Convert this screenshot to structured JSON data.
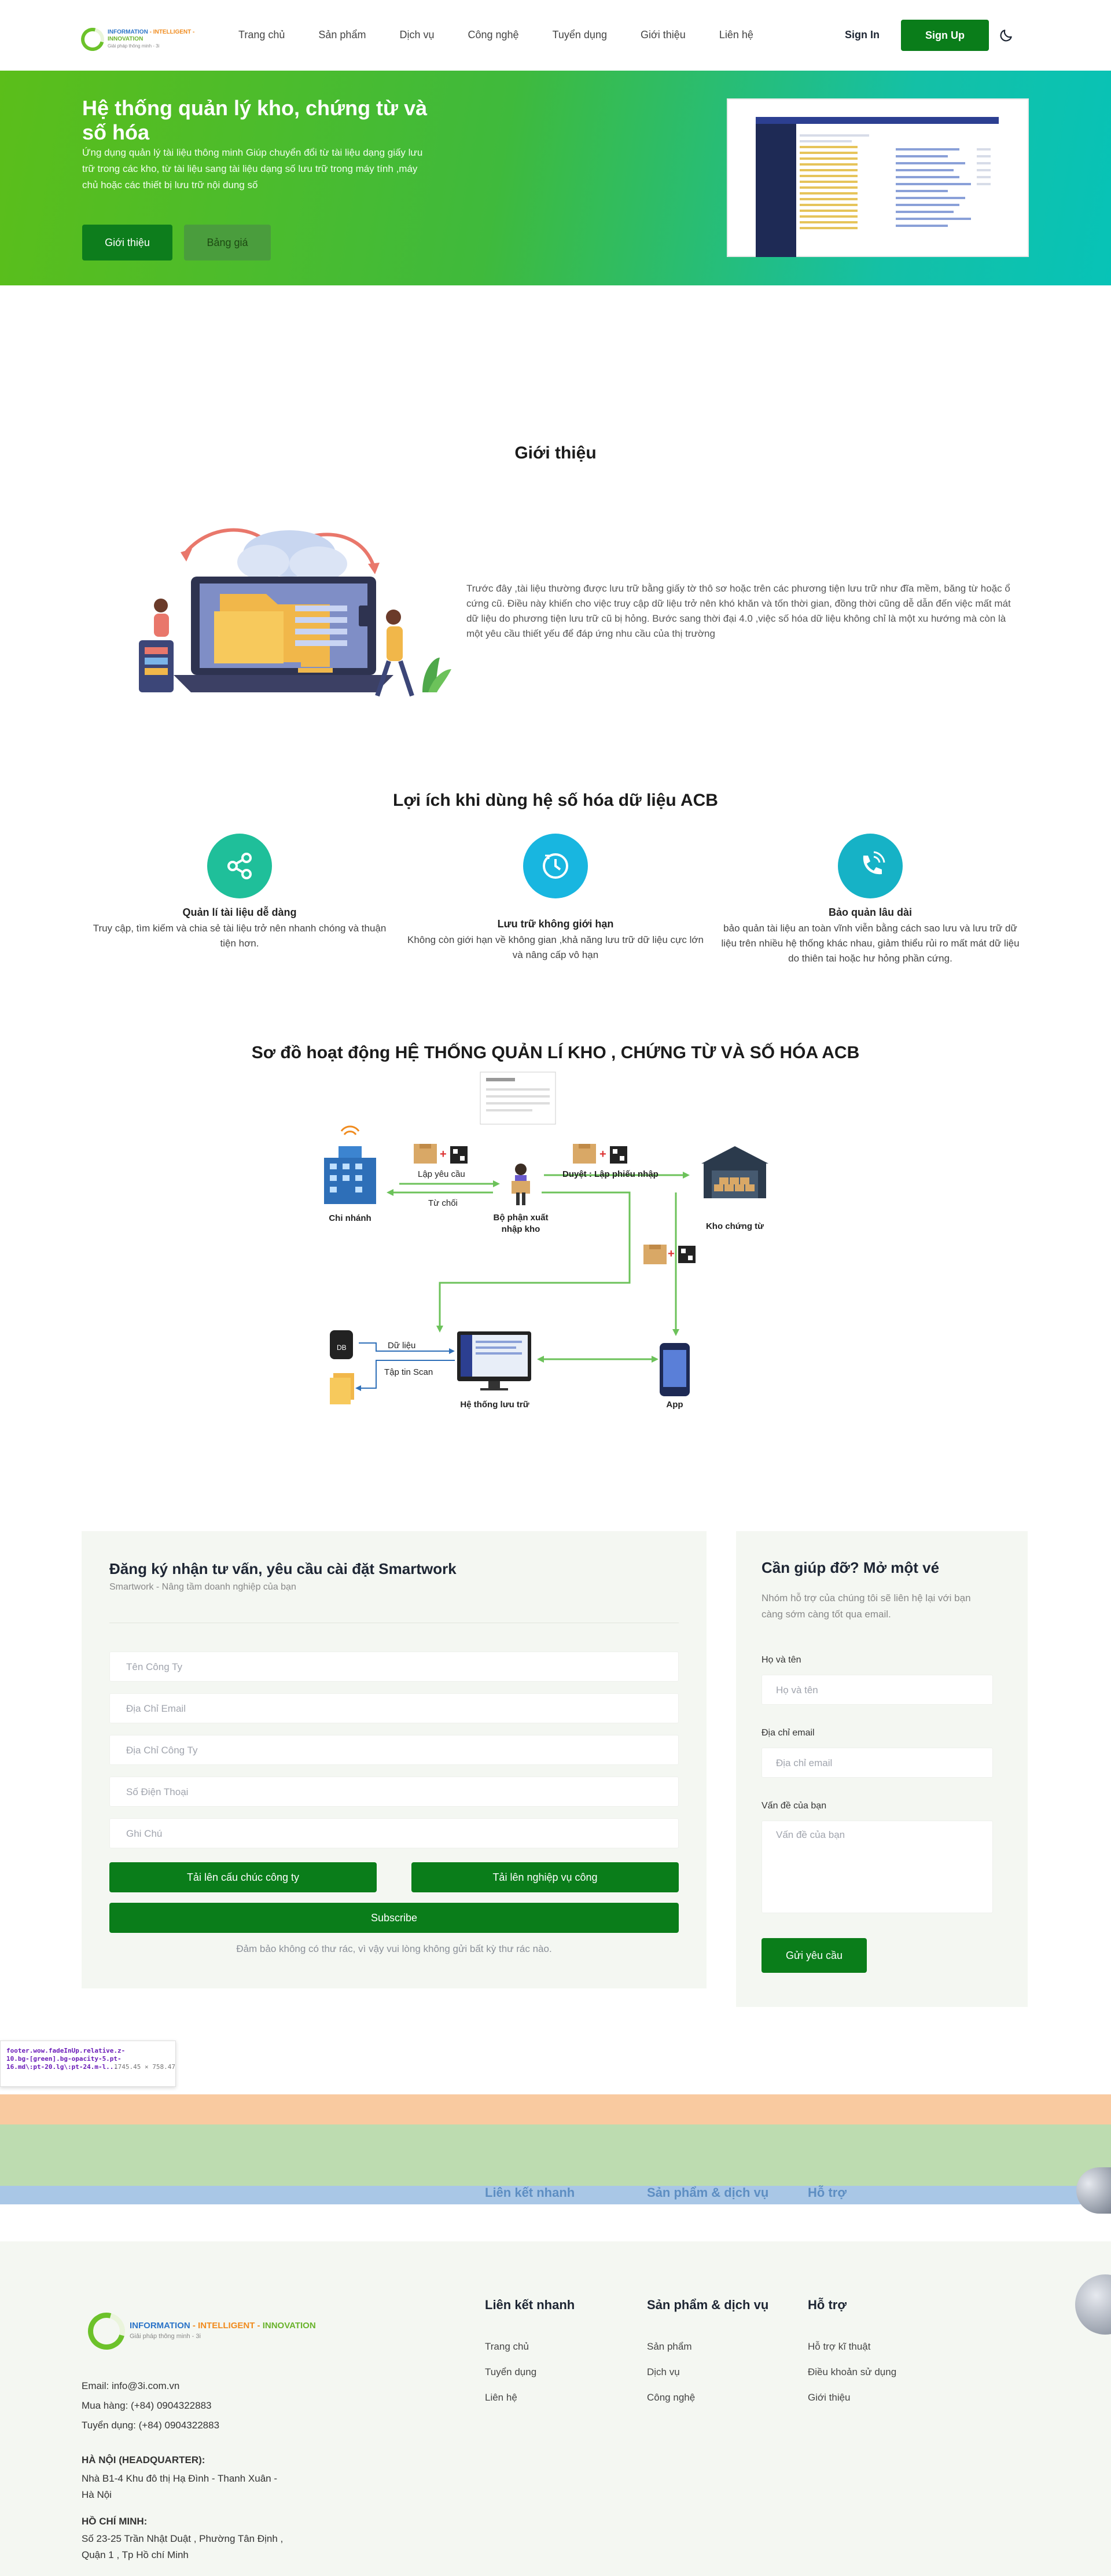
{
  "header": {
    "logo_text": [
      "INFORMATION",
      " - INTELLIGENT - ",
      "INNOVATION"
    ],
    "logo_sub": "Giải pháp thông minh - 3i",
    "nav": [
      "Trang chủ",
      "Sản phẩm",
      "Dịch vụ",
      "Công nghệ",
      "Tuyển dụng",
      "Giới thiệu",
      "Liên hệ"
    ],
    "sign_in": "Sign In",
    "sign_up": "Sign Up",
    "theme_icon": "moon-icon"
  },
  "hero": {
    "title": "Hệ thống quản lý kho, chứng từ và số hóa",
    "description": "Ứng dụng quản lý tài liệu thông minh Giúp chuyển đổi từ tài liệu dạng giấy lưu trữ trong các kho, từ tài liệu sang tài liệu dạng số lưu trữ trong máy tính ,máy chủ hoặc các thiết bị lưu trữ nội dung số",
    "btn_intro": "Giới thiệu",
    "btn_price": "Bảng giá"
  },
  "intro": {
    "title": "Giới thiệu",
    "text": "Trước đây ,tài liệu thường được lưu trữ bằng giấy tờ thô sơ hoặc trên các phương tiện lưu trữ như đĩa mềm, băng từ hoặc ổ cứng cũ. Điều này khiến cho việc truy cập dữ liệu trở nên khó khăn và tốn thời gian, đồng thời cũng dễ dẫn đến việc mất mát dữ liệu do phương tiện lưu trữ cũ bị hỏng. Bước sang thời đại 4.0 ,việc số hóa dữ liệu không chỉ là một xu hướng mà còn là một yêu cầu thiết yếu để đáp ứng nhu cầu của thị trường"
  },
  "benefits": {
    "title": "Lợi ích khi dùng hệ số hóa dữ liệu ACB",
    "items": [
      {
        "name": "Quản lí tài liệu dễ dàng",
        "desc": "Truy cập, tìm kiếm và chia sẻ tài liệu trở nên nhanh chóng và thuận tiện hơn.",
        "icon": "share-icon",
        "color": "#1fbf9a"
      },
      {
        "name": "Lưu trữ không giới hạn",
        "desc": "Không còn giới hạn về không gian ,khả năng lưu trữ dữ liệu cực lớn và nâng cấp vô hạn",
        "icon": "clock-icon",
        "color": "#18b6e0"
      },
      {
        "name": "Bảo quản lâu dài",
        "desc": "bảo quản tài liệu an toàn vĩnh viễn bằng cách sao lưu và lưu trữ dữ liệu trên nhiều hệ thống khác nhau, giảm thiểu rủi ro mất mát dữ liệu do thiên tai hoặc hư hỏng phần cứng.",
        "icon": "phone-icon",
        "color": "#16b2c6"
      }
    ]
  },
  "flow": {
    "title": "Sơ đồ hoạt động HỆ THỐNG QUẢN LÍ KHO , CHỨNG TỪ VÀ SỐ HÓA ACB",
    "nodes": {
      "branch": "Chi nhánh",
      "dept": "Bộ phận xuất nhập kho",
      "warehouse": "Kho chứng từ",
      "system": "Hệ thống lưu trữ",
      "app": "App"
    },
    "edges": {
      "request": "Lập yêu cầu",
      "reject": "Từ chối",
      "approve": "Duyệt : Lập phiếu nhập",
      "data": "Dữ liệu",
      "scan": "Tập tin Scan"
    }
  },
  "register_form": {
    "title": "Đăng ký nhận tư vấn, yêu cầu cài đặt Smartwork",
    "subtitle": "Smartwork - Nâng tầm doanh nghiệp của bạn",
    "placeholders": [
      "Tên Công Ty",
      "Địa Chỉ Email",
      "Địa Chỉ Công Ty",
      "Số Điện Thoại",
      "Ghi Chú"
    ],
    "upload_org": "Tải lên cấu chúc công ty",
    "upload_process": "Tải lên nghiệp vụ công",
    "subscribe": "Subscribe",
    "note": "Đảm bảo không có thư rác, vì vậy vui lòng không gửi bất kỳ thư rác nào."
  },
  "help_form": {
    "title": "Cần giúp đỡ? Mở một vé",
    "desc": "Nhóm hỗ trợ của chúng tôi sẽ liên hệ lại với bạn càng sớm càng tốt qua email.",
    "name_label": "Họ và tên",
    "name_placeholder": "Họ và tên",
    "email_label": "Địa chỉ email",
    "email_placeholder": "Địa chỉ email",
    "issue_label": "Vấn đề của bạn",
    "issue_placeholder": "Vấn đề của bạn",
    "submit": "Gửi yêu cầu"
  },
  "debug_overlay": {
    "selector": "footer.wow.fadeInUp.relative.z-10.bg-[green].bg-opacity-5.pt-16.md\\:pt-20.lg\\:pt-24.m-l...",
    "size": "1745.45 × 758.47"
  },
  "overlay_band": {
    "col1": "Liên kết nhanh",
    "col2": "Sản phẩm & dịch vụ",
    "col3": "Hỗ trợ"
  },
  "footer": {
    "email": "Email:  info@3i.com.vn",
    "sales": "Mua hàng:  (+84) 0904322883",
    "recruit": "Tuyển dụng:  (+84) 0904322883",
    "hq_title": "HÀ NỘI (HEADQUARTER):",
    "hq_addr": [
      "Nhà B1-4 Khu đô thị Hạ Đình - Thanh Xuân -",
      "Hà Nội"
    ],
    "hcm_title": "HỒ CHÍ MINH:",
    "hcm_addr": [
      "Số 23-25 Trần Nhật Duật , Phường Tân Định ,",
      "Quận 1 , Tp Hồ chí Minh"
    ],
    "col1_title": "Liên kết nhanh",
    "col1_links": [
      "Trang chủ",
      "Tuyển dụng",
      "Liên hệ"
    ],
    "col2_title": "Sản phẩm & dịch vụ",
    "col2_links": [
      "Sản phẩm",
      "Dịch vụ",
      "Công nghệ"
    ],
    "col3_title": "Hỗ trợ",
    "col3_links": [
      "Hỗ trợ kĩ thuật",
      "Điều khoản sử dụng",
      "Giới thiệu"
    ]
  },
  "colors": {
    "brand_green": "#0a7d1a",
    "hero_start": "#5bbe1a",
    "hero_end": "#07c3b7"
  }
}
